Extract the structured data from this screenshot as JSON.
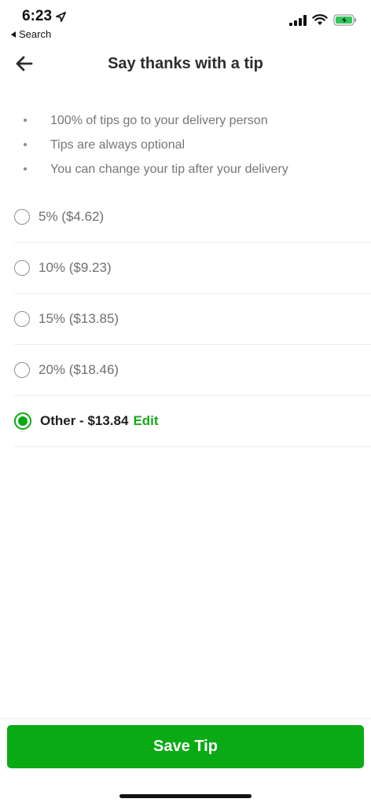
{
  "status_bar": {
    "time": "6:23",
    "back_app": "Search",
    "icons": [
      "location-arrow-icon",
      "cellular-signal-icon",
      "wifi-icon",
      "battery-charging-icon"
    ],
    "battery_color": "#33c759"
  },
  "header": {
    "title": "Say thanks with a tip",
    "back_icon": "back-arrow-icon"
  },
  "info_bullets": [
    "100% of tips go to your delivery person",
    "Tips are always optional",
    "You can change your tip after your delivery"
  ],
  "tip_options": [
    {
      "label": "5% ($4.62)",
      "selected": false
    },
    {
      "label": "10% ($9.23)",
      "selected": false
    },
    {
      "label": "15% ($13.85)",
      "selected": false
    },
    {
      "label": "20% ($18.46)",
      "selected": false
    },
    {
      "label": "Other - $13.84",
      "selected": true,
      "edit_label": "Edit"
    }
  ],
  "footer": {
    "save_label": "Save Tip"
  },
  "colors": {
    "accent": "#0aaa14",
    "edit_link": "#18a81c",
    "muted_text": "#767676"
  }
}
